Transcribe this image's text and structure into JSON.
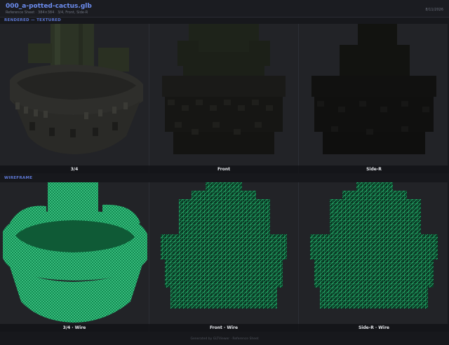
{
  "header": {
    "title": "000_a-potted-cactus.glb",
    "subtitle_left": "Reference Sheet",
    "subtitle_size": "384×384",
    "subtitle_views": "3/4, Front, Side-R",
    "date": "8/11/2026"
  },
  "sections": {
    "rendered": "RENDERED — TEXTURED",
    "wireframe": "WIREFRAME"
  },
  "rendered_views": [
    {
      "label": "3/4"
    },
    {
      "label": "Front"
    },
    {
      "label": "Side-R"
    }
  ],
  "wire_views": [
    {
      "label": "3/4 · Wire"
    },
    {
      "label": "Front · Wire"
    },
    {
      "label": "Side-R · Wire"
    }
  ],
  "footer": {
    "text": "Generated by GLTViewer · Reference Sheet"
  },
  "colors": {
    "accent": "#6c8df0",
    "wire": "#2fe08a",
    "panel_bg": "#222327"
  }
}
